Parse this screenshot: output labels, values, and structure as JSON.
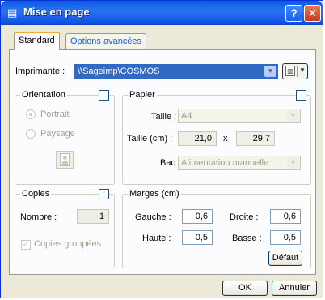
{
  "window": {
    "title": "Mise en page",
    "icon": "page-setup-icon",
    "help_icon": "help-icon",
    "close_icon": "close-icon"
  },
  "tabs": [
    {
      "label": "Standard",
      "active": true
    },
    {
      "label": "Options avancées",
      "active": false
    }
  ],
  "printer": {
    "label": "Imprimante :",
    "value": "\\\\Sageimp\\COSMOS"
  },
  "orientation": {
    "title": "Orientation",
    "portrait_label": "Portrait",
    "paysage_label": "Paysage",
    "selected": "Portrait"
  },
  "papier": {
    "title": "Papier",
    "taille_label": "Taille :",
    "taille_value": "A4",
    "taille_cm_label": "Taille (cm) :",
    "width_value": "21,0",
    "times": "x",
    "height_value": "29,7",
    "bac_label": "Bac :",
    "bac_value": "Alimentation manuelle"
  },
  "copies": {
    "title": "Copies",
    "nombre_label": "Nombre :",
    "nombre_value": "1",
    "groupees_label": "Copies groupées",
    "groupees_checked": true
  },
  "marges": {
    "title": "Marges (cm)",
    "gauche_label": "Gauche :",
    "gauche_value": "0,6",
    "droite_label": "Droite :",
    "droite_value": "0,6",
    "haute_label": "Haute :",
    "haute_value": "0,5",
    "basse_label": "Basse :",
    "basse_value": "0,5",
    "defaut_label": "Défaut"
  },
  "buttons": {
    "ok": "OK",
    "cancel": "Annuler"
  },
  "colors": {
    "titlebar": "#0a5ae0",
    "selection": "#316ac5",
    "tab_highlight": "#f1a836"
  }
}
